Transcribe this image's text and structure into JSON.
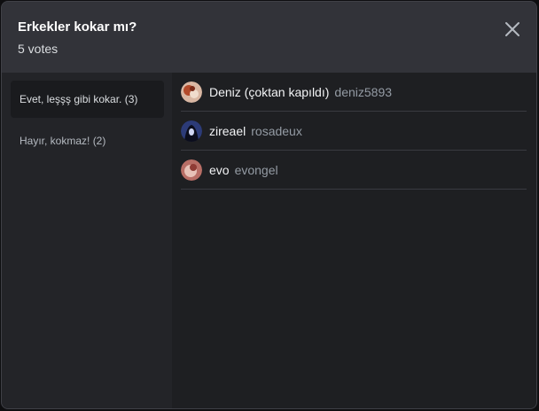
{
  "poll": {
    "title": "Erkekler kokar mı?",
    "votes_label": "5 votes"
  },
  "icons": {
    "close": "close-icon"
  },
  "answers": [
    {
      "label": "Evet, leşşş gibi kokar. (3)",
      "selected": true
    },
    {
      "label": "Hayır, kokmaz! (2)",
      "selected": false
    }
  ],
  "voters": [
    {
      "display_name": "Deniz (çoktan kapıldı)",
      "username": "deniz5893"
    },
    {
      "display_name": "zireael",
      "username": "rosadeux"
    },
    {
      "display_name": "evo",
      "username": "evongel"
    }
  ],
  "colors": {
    "background": "#323339",
    "sidebar": "#232428",
    "main": "#1e1f22",
    "selected_answer": "#1a1b1e",
    "username": "#949ba4"
  }
}
